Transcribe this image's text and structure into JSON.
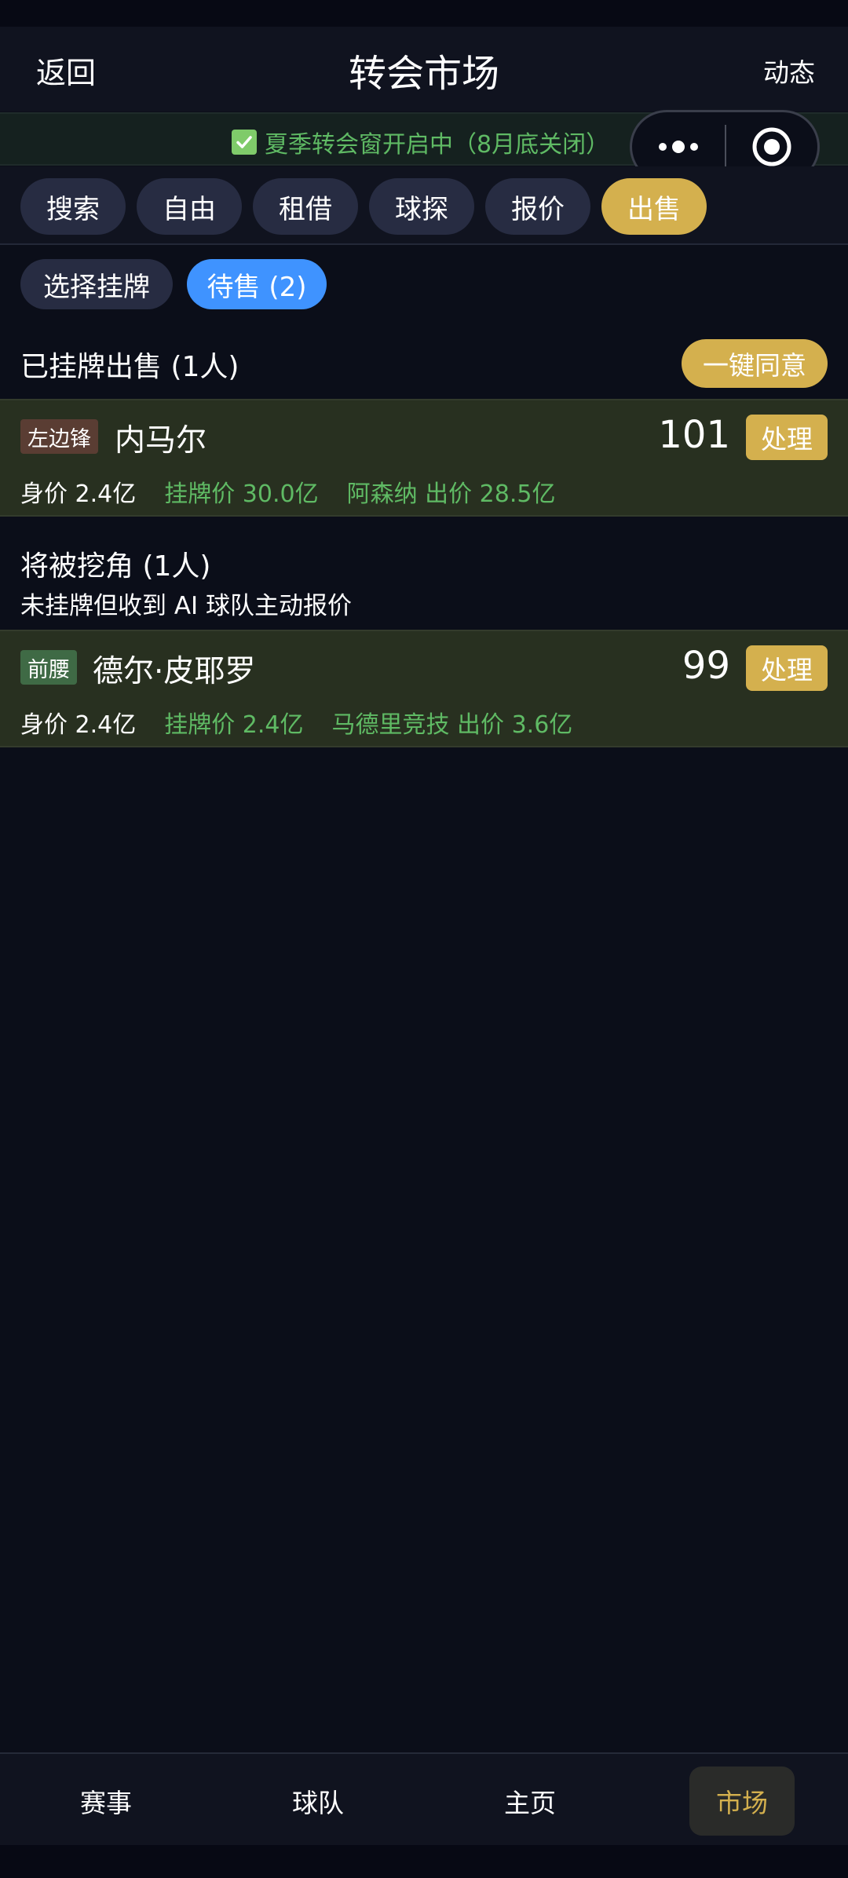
{
  "header": {
    "back_label": "返回",
    "title": "转会市场",
    "activity_label": "动态"
  },
  "notice": {
    "text": "夏季转会窗开启中（8月底关闭）",
    "icon": "check-icon",
    "color": "#5fba64"
  },
  "capsule": {
    "more_icon": "more-icon",
    "close_icon": "target-icon"
  },
  "filter_tabs": [
    {
      "label": "搜索",
      "active": false
    },
    {
      "label": "自由",
      "active": false
    },
    {
      "label": "租借",
      "active": false
    },
    {
      "label": "球探",
      "active": false
    },
    {
      "label": "报价",
      "active": false
    },
    {
      "label": "出售",
      "active": true
    }
  ],
  "sub_tabs": [
    {
      "label": "选择挂牌",
      "active": false
    },
    {
      "label": "待售 (2)",
      "active": true
    }
  ],
  "listed_section": {
    "title": "已挂牌出售 (1人)",
    "action_label": "一键同意",
    "players": [
      {
        "position": "左边锋",
        "name": "内马尔",
        "rating": "101",
        "action_label": "处理",
        "value": "身价 2.4亿",
        "list_price": "挂牌价 30.0亿",
        "offer": "阿森纳 出价 28.5亿"
      }
    ]
  },
  "poach_section": {
    "title": "将被挖角 (1人)",
    "subtitle": "未挂牌但收到 AI 球队主动报价",
    "players": [
      {
        "position": "前腰",
        "name": "德尔·皮耶罗",
        "rating": "99",
        "action_label": "处理",
        "value": "身价 2.4亿",
        "list_price": "挂牌价 2.4亿",
        "offer": "马德里竞技 出价 3.6亿"
      }
    ]
  },
  "bottom_nav": [
    {
      "label": "赛事",
      "active": false
    },
    {
      "label": "球队",
      "active": false
    },
    {
      "label": "主页",
      "active": false
    },
    {
      "label": "市场",
      "active": true
    }
  ],
  "colors": {
    "accent_gold": "#d4b04e",
    "accent_blue": "#3f93ff",
    "text_green": "#5fba64",
    "background": "#0b0e19"
  }
}
